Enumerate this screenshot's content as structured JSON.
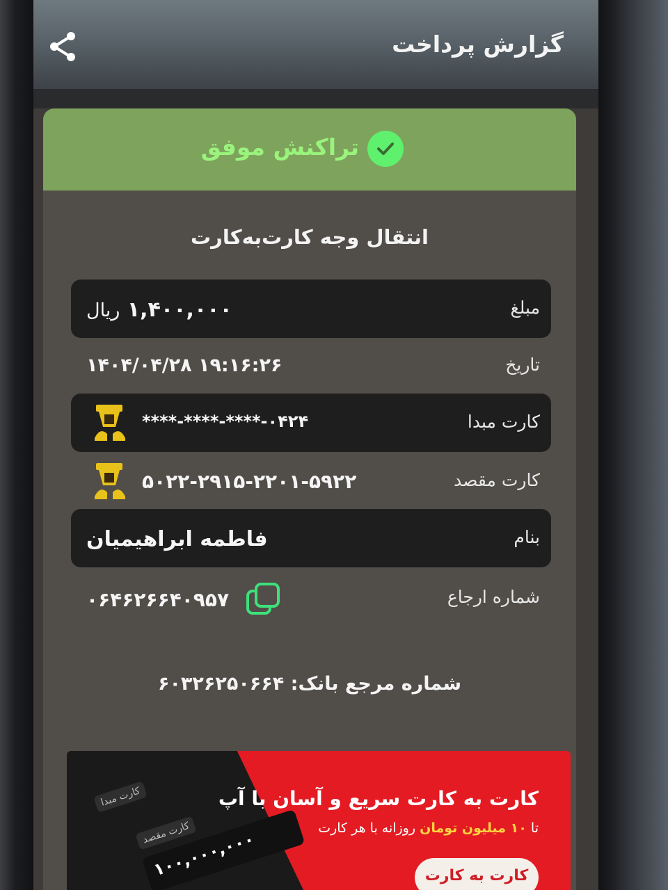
{
  "header": {
    "title": "گزارش پرداخت"
  },
  "status": {
    "text": "تراکنش موفق",
    "color": "#5ff06e"
  },
  "transaction": {
    "title": "انتقال وجه کارت‌به‌کارت",
    "amount": {
      "label": "مبلغ",
      "value": "۱,۴۰۰,۰۰۰",
      "unit": "ریال"
    },
    "date": {
      "label": "تاریخ",
      "value": "۱۴۰۴/۰۴/۲۸ ۱۹:۱۶:۲۶"
    },
    "source_card": {
      "label": "کارت مبدا",
      "value": "****-****-****-۰۴۲۴"
    },
    "dest_card": {
      "label": "کارت مقصد",
      "value": "۵۰۲۲-۲۹۱۵-۲۲۰۱-۵۹۲۲"
    },
    "name": {
      "label": "بنام",
      "value": "فاطمه ابراهیمیان"
    },
    "reference": {
      "label": "شماره ارجاع",
      "value": "۰۶۴۶۲۶۶۴۰۹۵۷"
    },
    "bank_ref": {
      "label": "شماره مرجع بانک:",
      "value": "۶۰۳۲۶۲۵۰۶۶۴"
    }
  },
  "banner": {
    "title": "کارت به کارت سریع و آسان با آپ",
    "subtitle_prefix": "تا",
    "subtitle_highlight": "۱۰ میلیون تومان",
    "subtitle_suffix": "روزانه با هر کارت",
    "button": "کارت به کارت",
    "mini_card_source": "کارت مبدا",
    "mini_card_dest": "کارت مقصد",
    "mini_amount": "۱۰۰,۰۰۰,۰۰۰"
  },
  "icons": {
    "share": "share-icon",
    "check": "check-circle-icon",
    "copy": "copy-icon",
    "bank_logo": "bank-logo-icon"
  },
  "colors": {
    "status_bar": "#7ea35c",
    "status_text": "#9af37c",
    "banner_red": "#e41b23",
    "bank_logo_gold": "#e8c21a"
  }
}
